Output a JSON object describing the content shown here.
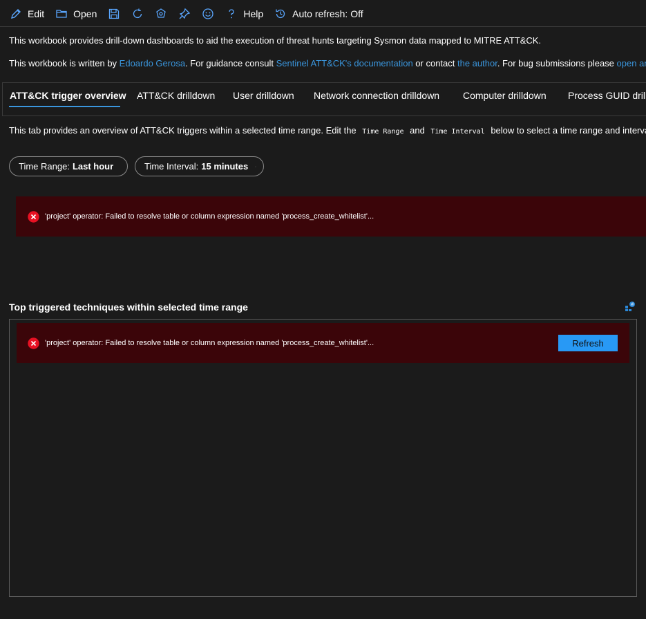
{
  "toolbar": {
    "edit_label": "Edit",
    "open_label": "Open",
    "help_label": "Help",
    "auto_refresh_label": "Auto refresh: Off",
    "icons": [
      "edit-icon",
      "open-icon",
      "save-icon",
      "refresh-icon",
      "share-icon",
      "pin-icon",
      "feedback-icon",
      "help-icon",
      "auto-refresh-icon"
    ]
  },
  "intro": {
    "line1": "This workbook provides drill-down dashboards to aid the execution of threat hunts targeting Sysmon data mapped to MITRE ATT&CK.",
    "line2_prefix": "This workbook is written by ",
    "author_link": "Edoardo Gerosa",
    "line2_mid1": ". For guidance consult ",
    "docs_link": "Sentinel ATT&CK's documentation",
    "line2_mid2": " or contact ",
    "contact_link": "the author",
    "line2_mid3": ". For bug submissions please ",
    "bug_link": "open an"
  },
  "tabs": [
    {
      "label": "ATT&CK trigger overview",
      "active": true
    },
    {
      "label": "ATT&CK drilldown"
    },
    {
      "label": "User drilldown"
    },
    {
      "label": "Network connection drilldown"
    },
    {
      "label": "Computer drilldown"
    },
    {
      "label": "Process GUID drilldo"
    }
  ],
  "tab_description": {
    "prefix": "This tab provides an overview of ATT&CK triggers within a selected time range. Edit the ",
    "code1": "Time Range",
    "mid": " and ",
    "code2": "Time Interval",
    "suffix": " below to select a time range and interval"
  },
  "params": {
    "time_range_label": "Time Range:",
    "time_range_value": "Last hour",
    "time_interval_label": "Time Interval:",
    "time_interval_value": "15 minutes"
  },
  "errors": {
    "top_message": "'project' operator: Failed to resolve table or column expression named 'process_create_whitelist'...",
    "panel_message": "'project' operator: Failed to resolve table or column expression named 'process_create_whitelist'..."
  },
  "section": {
    "title": "Top triggered techniques within selected time range",
    "refresh_label": "Refresh"
  },
  "colors": {
    "background": "#1b1b1b",
    "link": "#3a96dd",
    "error_bg": "#3b0509",
    "error_icon": "#e81123",
    "button": "#2899f5"
  }
}
